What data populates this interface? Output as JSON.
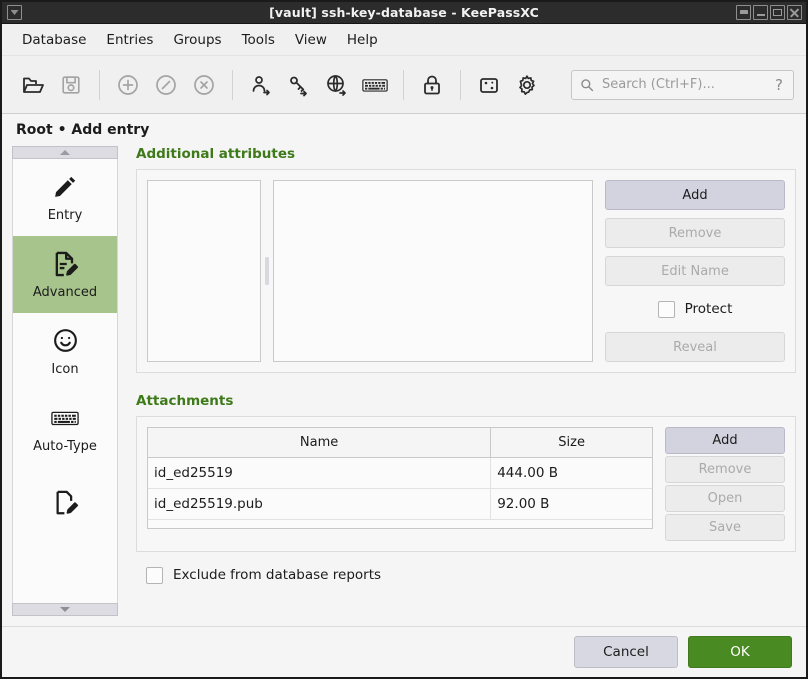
{
  "window": {
    "title": "[vault] ssh-key-database - KeePassXC",
    "app_icon": "keepassxc-icon",
    "buttons": [
      {
        "name": "shade-button",
        "label": "Shade"
      },
      {
        "name": "minimize-button",
        "label": "Minimize"
      },
      {
        "name": "maximize-button",
        "label": "Maximize"
      },
      {
        "name": "close-button",
        "label": "Close"
      }
    ]
  },
  "menubar": {
    "items": [
      {
        "label": "Database"
      },
      {
        "label": "Entries"
      },
      {
        "label": "Groups"
      },
      {
        "label": "Tools"
      },
      {
        "label": "View"
      },
      {
        "label": "Help"
      }
    ]
  },
  "toolbar": {
    "buttons": [
      {
        "name": "open-database-icon",
        "enabled": true
      },
      {
        "name": "save-database-icon",
        "enabled": false
      },
      {
        "name": "add-entry-icon",
        "enabled": false
      },
      {
        "name": "edit-entry-icon",
        "enabled": false
      },
      {
        "name": "delete-entry-icon",
        "enabled": false
      },
      {
        "name": "copy-username-icon",
        "enabled": true
      },
      {
        "name": "copy-password-icon",
        "enabled": true
      },
      {
        "name": "copy-url-icon",
        "enabled": true
      },
      {
        "name": "auto-type-icon",
        "enabled": true
      },
      {
        "name": "lock-database-icon",
        "enabled": true
      },
      {
        "name": "password-generator-icon",
        "enabled": true
      },
      {
        "name": "settings-icon",
        "enabled": true
      }
    ]
  },
  "search": {
    "placeholder": "Search (Ctrl+F)...",
    "value": "",
    "help_label": "?"
  },
  "page": {
    "breadcrumb": "Root • Add entry"
  },
  "sidebar": {
    "scroll_up": "▲",
    "scroll_down": "▼",
    "items": [
      {
        "label": "Entry",
        "icon": "pencil-icon",
        "selected": false
      },
      {
        "label": "Advanced",
        "icon": "document-edit-icon",
        "selected": true
      },
      {
        "label": "Icon",
        "icon": "smiley-icon",
        "selected": false
      },
      {
        "label": "Auto-Type",
        "icon": "keyboard-icon",
        "selected": false
      },
      {
        "label": "",
        "icon": "properties-icon",
        "selected": false
      }
    ]
  },
  "attributes": {
    "title": "Additional attributes",
    "keys": [],
    "value_text": "",
    "buttons": [
      {
        "label": "Add",
        "enabled": true,
        "style": "primary"
      },
      {
        "label": "Remove",
        "enabled": false,
        "style": "normal"
      },
      {
        "label": "Edit Name",
        "enabled": false,
        "style": "normal"
      }
    ],
    "protect_label": "Protect",
    "protect_checked": false,
    "reveal": {
      "label": "Reveal",
      "enabled": false
    }
  },
  "attachments": {
    "title": "Attachments",
    "columns": [
      "Name",
      "Size"
    ],
    "rows": [
      {
        "name": "id_ed25519",
        "size": "444.00 B"
      },
      {
        "name": "id_ed25519.pub",
        "size": "92.00 B"
      }
    ],
    "buttons": [
      {
        "label": "Add",
        "enabled": true,
        "style": "primary"
      },
      {
        "label": "Remove",
        "enabled": false,
        "style": "normal"
      },
      {
        "label": "Open",
        "enabled": false,
        "style": "normal"
      },
      {
        "label": "Save",
        "enabled": false,
        "style": "normal"
      }
    ]
  },
  "footer": {
    "exclude_label": "Exclude from database reports",
    "exclude_checked": false,
    "cancel_label": "Cancel",
    "ok_label": "OK"
  },
  "colors": {
    "accent_green": "#3e7a19",
    "ok_green": "#4a8a22",
    "selected_green": "#a8c48d",
    "titlebar": "#2c2c2c"
  }
}
